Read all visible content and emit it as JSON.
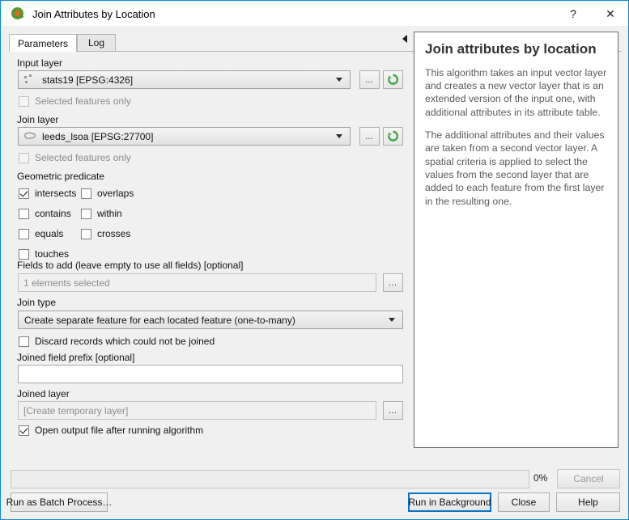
{
  "window": {
    "title": "Join Attributes by Location",
    "app_icon": "qgis-logo-icon",
    "help_button": "?",
    "close_button": "✕"
  },
  "tabs": [
    {
      "label": "Parameters",
      "active": true
    },
    {
      "label": "Log",
      "active": false
    }
  ],
  "parameters": {
    "input_layer": {
      "label": "Input layer",
      "value": "stats19 [EPSG:4326]",
      "geometry_icon": "point-layer-icon",
      "browse_button": "…",
      "iterate_button_icon": "refresh-iterate-icon"
    },
    "input_selected_only": {
      "label": "Selected features only",
      "checked": false,
      "enabled": false
    },
    "join_layer": {
      "label": "Join layer",
      "value": "leeds_lsoa [EPSG:27700]",
      "geometry_icon": "polygon-layer-icon",
      "browse_button": "…",
      "iterate_button_icon": "refresh-iterate-icon"
    },
    "join_selected_only": {
      "label": "Selected features only",
      "checked": false,
      "enabled": false
    },
    "geometric_predicate": {
      "label": "Geometric predicate",
      "options": [
        {
          "label": "intersects",
          "checked": true
        },
        {
          "label": "overlaps",
          "checked": false
        },
        {
          "label": "contains",
          "checked": false
        },
        {
          "label": "within",
          "checked": false
        },
        {
          "label": "equals",
          "checked": false
        },
        {
          "label": "crosses",
          "checked": false
        },
        {
          "label": "touches",
          "checked": false
        }
      ]
    },
    "fields_to_add": {
      "label": "Fields to add (leave empty to use all fields) [optional]",
      "value": "1 elements selected",
      "browse_button": "…"
    },
    "join_type": {
      "label": "Join type",
      "value": "Create separate feature for each located feature (one-to-many)"
    },
    "discard_records": {
      "label": "Discard records which could not be joined",
      "checked": false
    },
    "joined_field_prefix": {
      "label": "Joined field prefix [optional]",
      "value": ""
    },
    "joined_layer": {
      "label": "Joined layer",
      "placeholder": "[Create temporary layer]",
      "browse_button": "…"
    },
    "open_output": {
      "label": "Open output file after running algorithm",
      "checked": true
    }
  },
  "help": {
    "title": "Join attributes by location",
    "paragraph1": "This algorithm takes an input vector layer and creates a new vector layer that is an extended version of the input one, with additional attributes in its attribute table.",
    "paragraph2": "The additional attributes and their values are taken from a second vector layer. A spatial criteria is applied to select the values from the second layer that are added to each feature from the first layer in the resulting one.",
    "collapse_icon": "collapse-left-arrow-icon"
  },
  "footer": {
    "progress_percent": "0%",
    "progress_value": 0,
    "batch_button": "Run as Batch Process…",
    "cancel_button": "Cancel",
    "cancel_enabled": false,
    "run_button": "Run in Background",
    "run_focused": true,
    "close_button": "Close",
    "help_button": "Help"
  },
  "colors": {
    "window_border": "#1a88c9",
    "focus_outline": "#0a74c0",
    "panel_bg": "#f0f0f0",
    "help_text": "#5a5a5a"
  }
}
